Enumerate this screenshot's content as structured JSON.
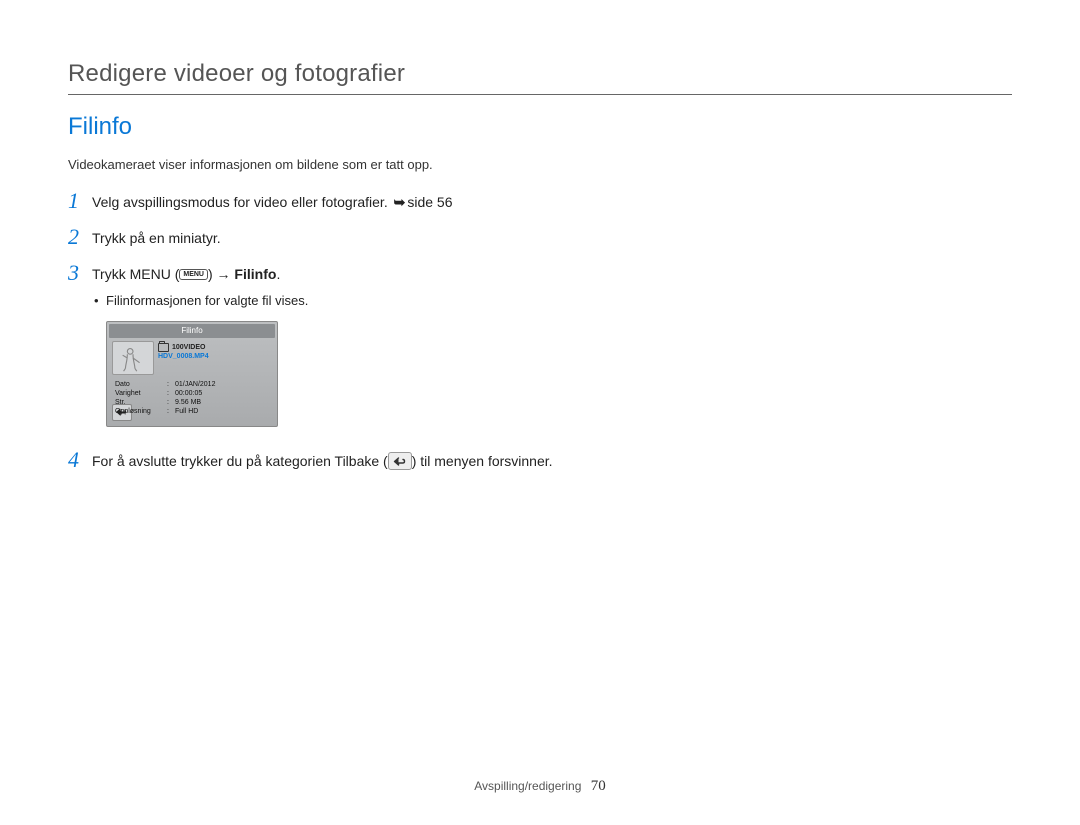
{
  "chapter_title": "Redigere videoer og fotografier",
  "section_title": "Filinfo",
  "intro": "Videokameraet viser informasjonen om bildene som er tatt opp.",
  "steps": {
    "s1": {
      "num": "1",
      "text_pre": "Velg avspillingsmodus for video eller fotografier. ",
      "ref_arrow": "➥",
      "ref": "side 56"
    },
    "s2": {
      "num": "2",
      "text": "Trykk på en miniatyr."
    },
    "s3": {
      "num": "3",
      "text_pre": "Trykk MENU (",
      "menu_label": "MENU",
      "text_mid": ") ",
      "arrow": "→",
      "target": " Filinfo",
      "suffix": ".",
      "bullet": "Filinformasjonen for valgte fil vises."
    },
    "s4": {
      "num": "4",
      "text_pre": "For å avslutte trykker du på kategorien Tilbake (",
      "text_post": ") til menyen forsvinner."
    }
  },
  "device": {
    "header": "Filinfo",
    "folder": "100VIDEO",
    "filename": "HDV_0008.MP4",
    "rows": {
      "dato": {
        "k": "Dato",
        "v": "01/JAN/2012"
      },
      "varighet": {
        "k": "Varighet",
        "v": "00:00:05"
      },
      "str": {
        "k": "Str.",
        "v": "9.56 MB"
      },
      "opplosning": {
        "k": "Oppløsning",
        "v": "Full HD"
      }
    }
  },
  "footer": {
    "section": "Avspilling/redigering",
    "page": "70"
  }
}
